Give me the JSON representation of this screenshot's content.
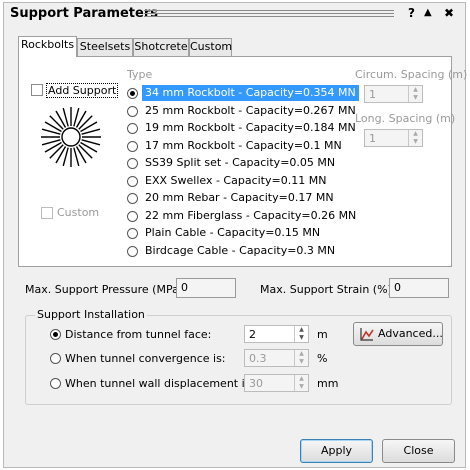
{
  "window": {
    "title": "Support Parameters",
    "help_label": "?",
    "collapse_label": "▲",
    "close_label": "✖"
  },
  "tabs": [
    {
      "label": "Rockbolts"
    },
    {
      "label": "Steelsets"
    },
    {
      "label": "Shotcrete"
    },
    {
      "label": "Custom"
    }
  ],
  "rockbolts": {
    "add_support_label": "Add Support",
    "add_support_checked": false,
    "custom_label": "Custom",
    "custom_checked": false,
    "type_header": "Type",
    "selected_index": 0,
    "types": [
      {
        "label": "34 mm Rockbolt - Capacity=0.354 MN"
      },
      {
        "label": "25 mm Rockbolt - Capacity=0.267 MN"
      },
      {
        "label": "19 mm Rockbolt - Capacity=0.184 MN"
      },
      {
        "label": "17 mm Rockbolt - Capacity=0.1 MN"
      },
      {
        "label": "SS39 Split set - Capacity=0.05 MN"
      },
      {
        "label": "EXX Swellex - Capacity=0.11 MN"
      },
      {
        "label": "20 mm Rebar - Capacity=0.17 MN"
      },
      {
        "label": "22 mm Fiberglass - Capacity=0.26 MN"
      },
      {
        "label": "Plain Cable - Capacity=0.15 MN"
      },
      {
        "label": "Birdcage Cable - Capacity=0.3 MN"
      }
    ],
    "circum_spacing_label": "Circum. Spacing (m)",
    "circum_spacing_value": "1",
    "long_spacing_label": "Long. Spacing (m)",
    "long_spacing_value": "1"
  },
  "max_pressure": {
    "label": "Max. Support Pressure (MPa):",
    "value": "0"
  },
  "max_strain": {
    "label": "Max. Support Strain (%):",
    "value": "0"
  },
  "installation": {
    "title": "Support Installation",
    "selected_index": 0,
    "options": [
      {
        "label": "Distance from tunnel face:",
        "value": "2",
        "unit": "m"
      },
      {
        "label": "When tunnel convergence is:",
        "value": "0.3",
        "unit": "%"
      },
      {
        "label": "When tunnel wall displacement is:",
        "value": "30",
        "unit": "mm"
      }
    ],
    "advanced_label": "Advanced..."
  },
  "buttons": {
    "apply_label": "Apply",
    "close_label": "Close"
  },
  "colors": {
    "selection": "#3399ff",
    "accent_icon": "#c0392b"
  }
}
